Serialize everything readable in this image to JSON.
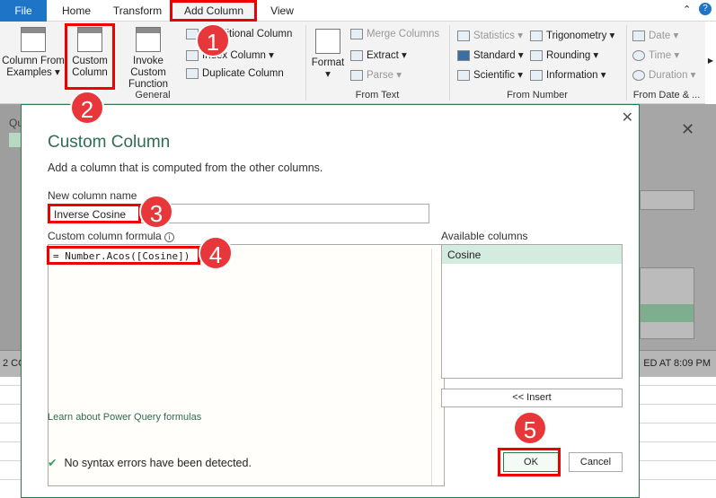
{
  "tabs": [
    "File",
    "Home",
    "Transform",
    "Add Column",
    "View"
  ],
  "ribbon": {
    "general": {
      "column_from_examples": "Column From Examples",
      "custom_column": "Custom Column",
      "invoke_custom_function": "Invoke Custom Function",
      "conditional_column": "Conditional Column",
      "index_column": "Index Column",
      "duplicate_column": "Duplicate Column",
      "group": "General"
    },
    "from_text": {
      "format": "Format",
      "merge_columns": "Merge Columns",
      "extract": "Extract",
      "parse": "Parse",
      "group": "From Text"
    },
    "from_number": {
      "statistics": "Statistics",
      "standard": "Standard",
      "scientific": "Scientific",
      "trigonometry": "Trigonometry",
      "rounding": "Rounding",
      "information": "Information",
      "group": "From Number"
    },
    "from_date": {
      "date": "Date",
      "time": "Time",
      "duration": "Duration",
      "group": "From Date & ..."
    }
  },
  "background": {
    "queries_label": "Qu",
    "status_left": "2 CO",
    "status_right": "ED AT 8:09 PM"
  },
  "dialog": {
    "title": "Custom Column",
    "description": "Add a column that is computed from the other columns.",
    "name_label": "New column name",
    "name_value": "Inverse Cosine",
    "formula_label": "Custom column formula",
    "formula_value": "= Number.Acos([Cosine])",
    "available_label": "Available columns",
    "available_columns": [
      "Cosine"
    ],
    "insert": "<< Insert",
    "learn_link": "Learn about Power Query formulas",
    "status": "No syntax errors have been detected.",
    "ok": "OK",
    "cancel": "Cancel"
  },
  "steps": [
    "1",
    "2",
    "3",
    "4",
    "5"
  ],
  "colors": {
    "accent": "#217346",
    "file_tab": "#1e74c6",
    "highlight": "#e00000",
    "badge": "#e8373a"
  }
}
